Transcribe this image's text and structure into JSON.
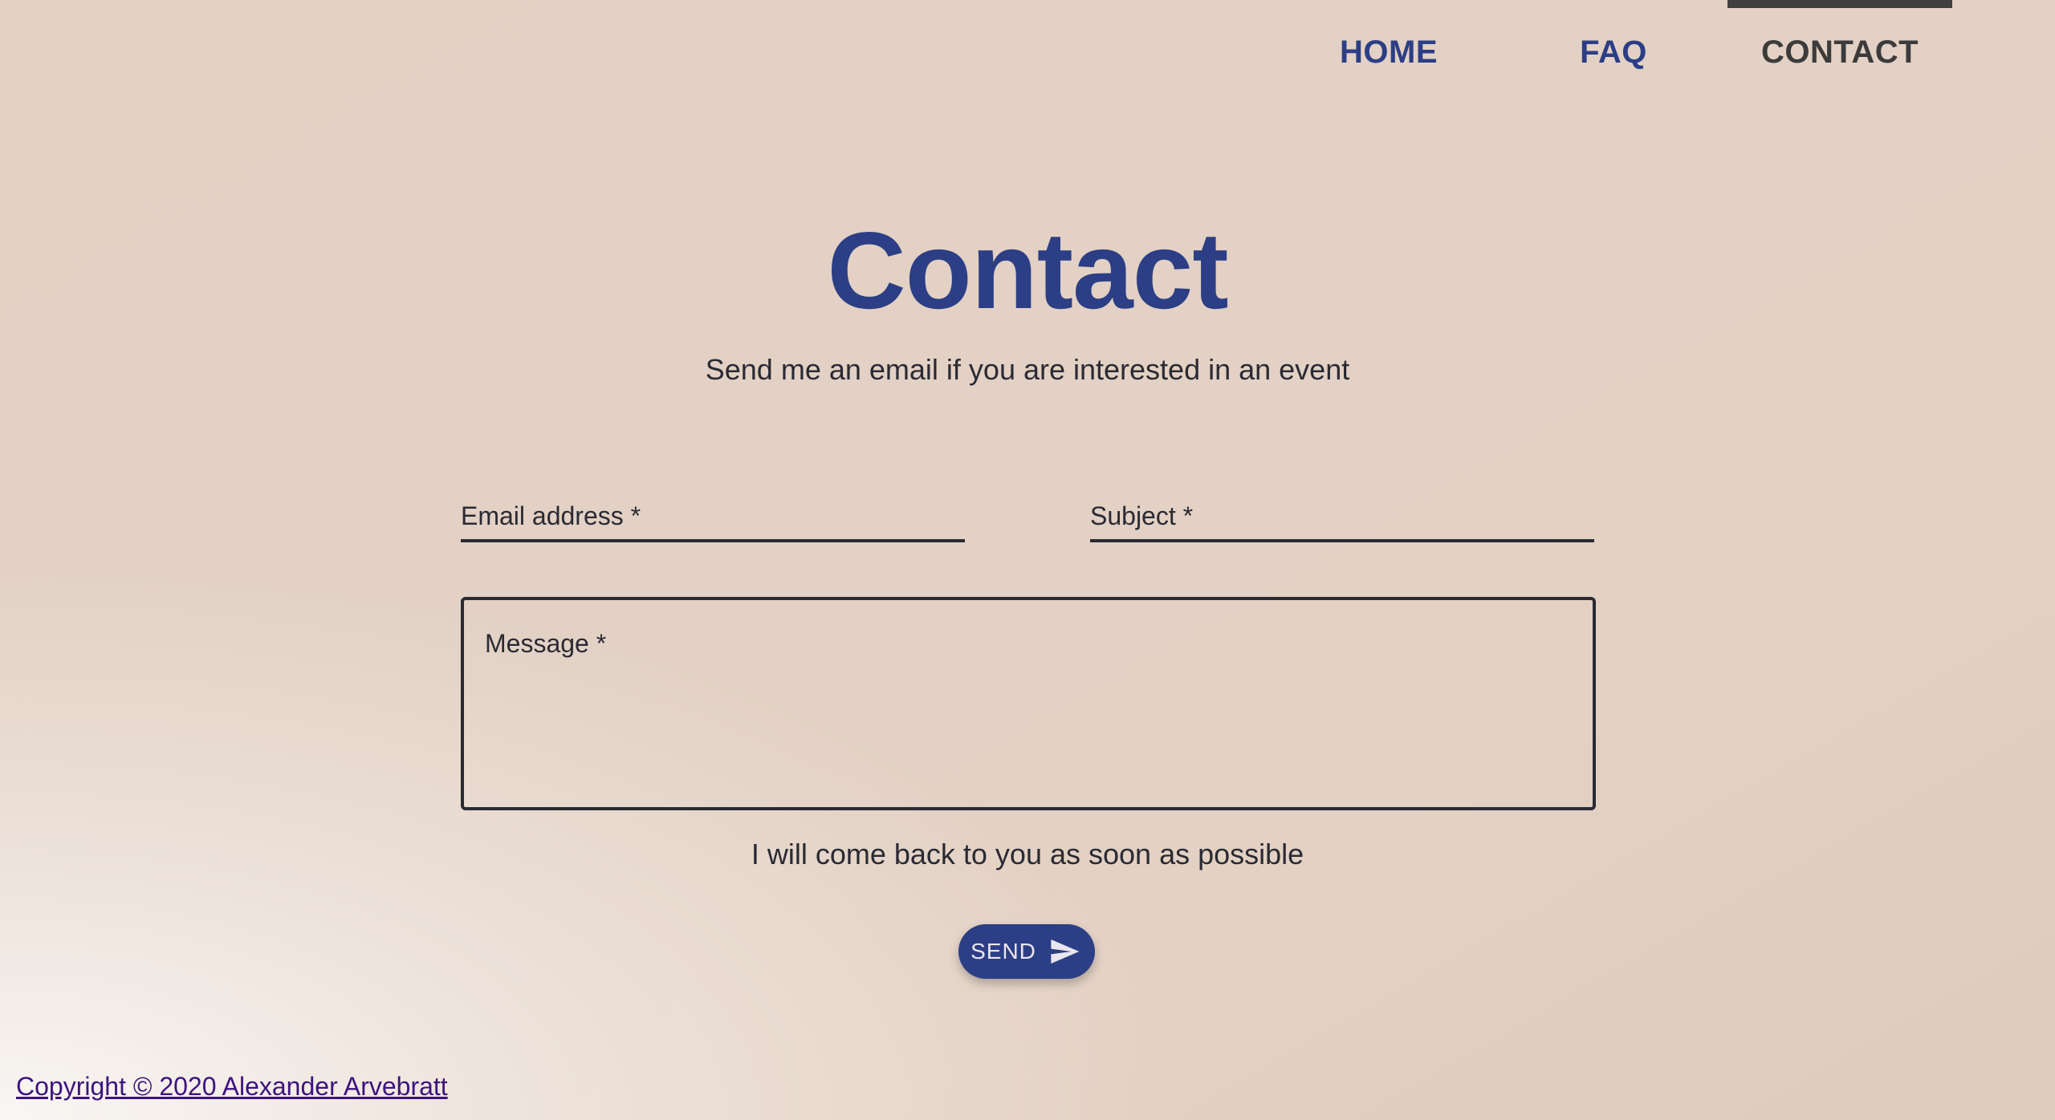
{
  "nav": {
    "items": [
      {
        "label": "HOME",
        "active": false
      },
      {
        "label": "FAQ",
        "active": false
      },
      {
        "label": "CONTACT",
        "active": true
      }
    ]
  },
  "page": {
    "title": "Contact",
    "subtitle": "Send me an email if you are interested in an event"
  },
  "form": {
    "email_label": "Email address *",
    "subject_label": "Subject *",
    "message_label": "Message *",
    "email_value": "",
    "subject_value": "",
    "message_value": "",
    "note": "I will come back to you as soon as possible",
    "send_label": "SEND",
    "send_icon": "send-icon"
  },
  "footer": {
    "copyright": "Copyright © 2020 Alexander Arvebratt"
  },
  "colors": {
    "accent": "#2c3e85",
    "text": "#2a2a33",
    "link_visited": "#3d137e",
    "background": "#e2d0c3"
  }
}
